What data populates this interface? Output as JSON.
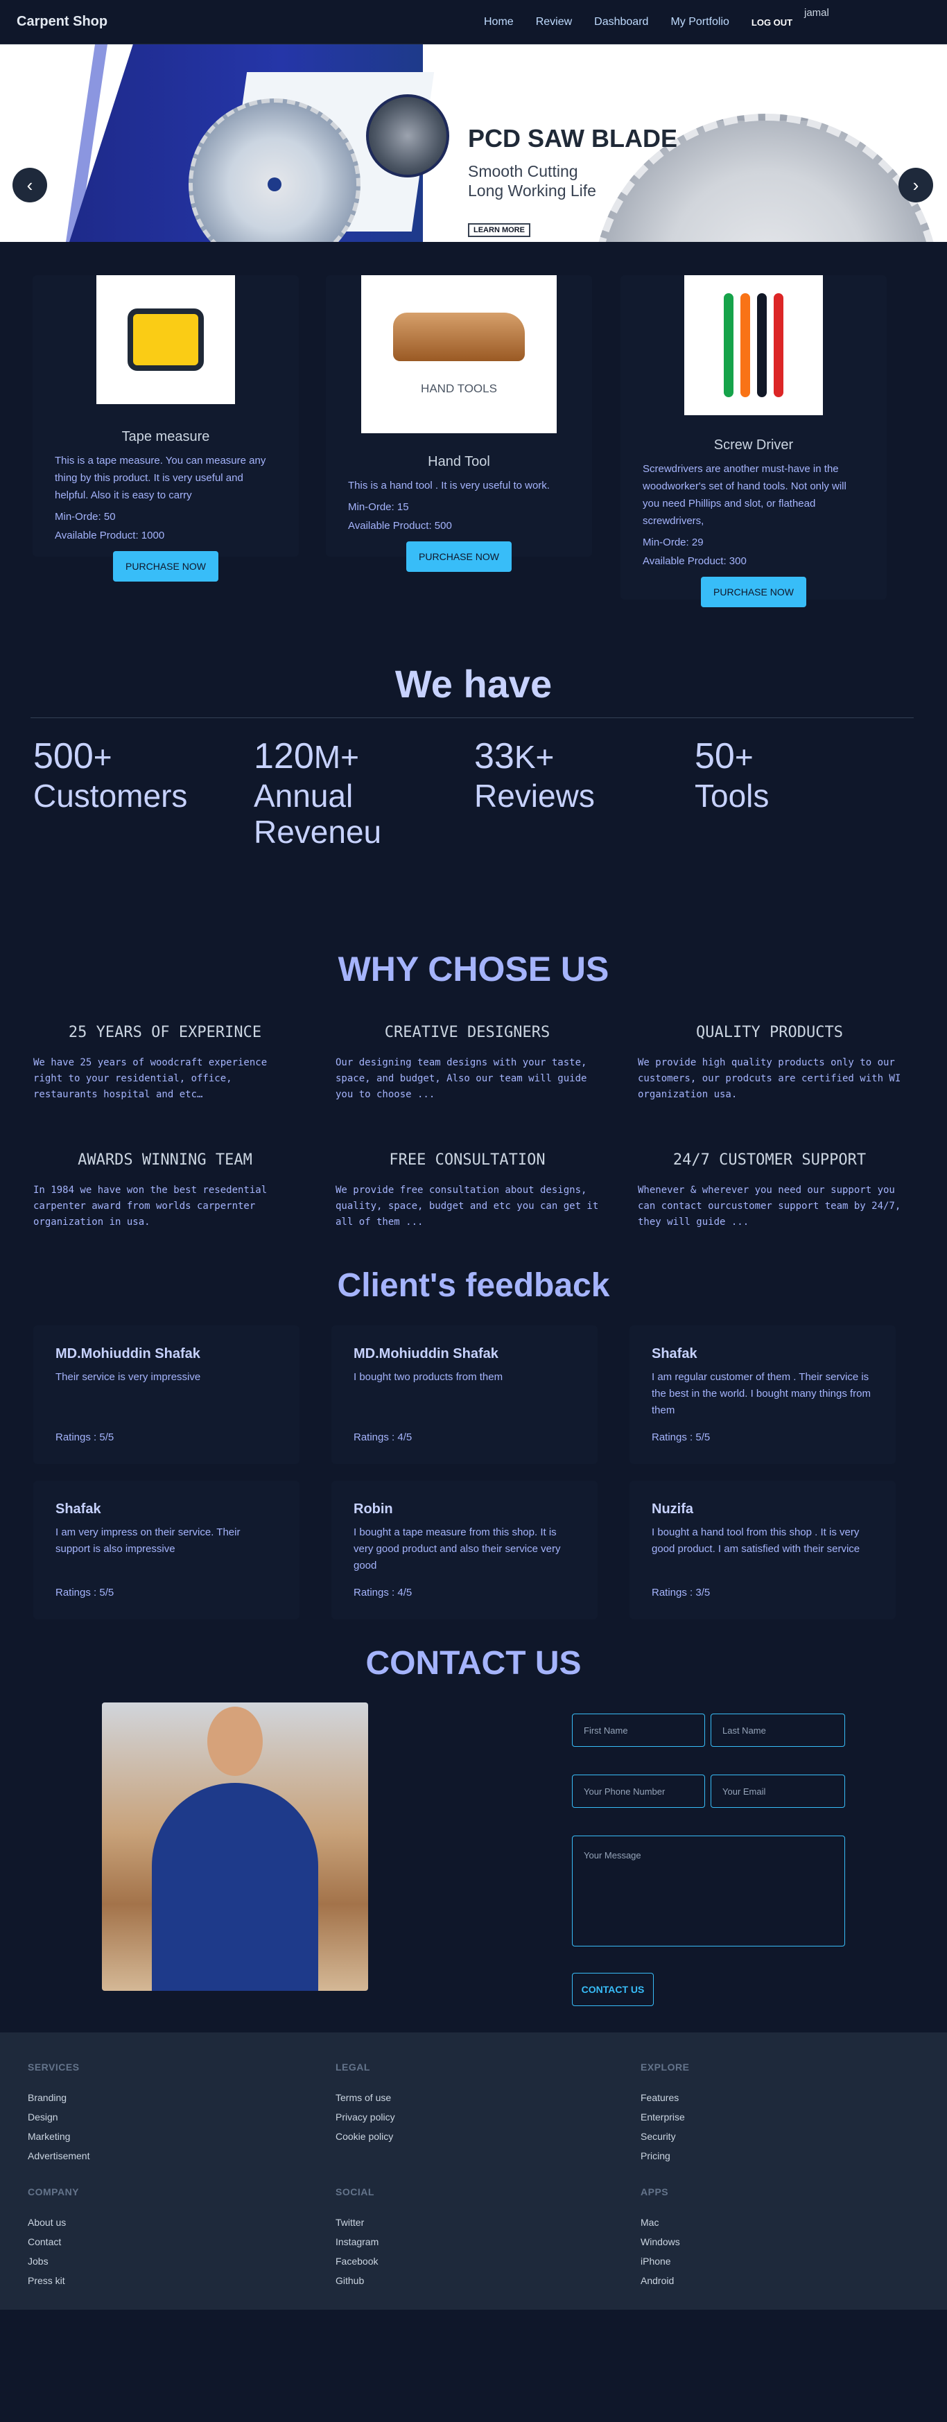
{
  "nav": {
    "brand": "Carpent Shop",
    "links": [
      "Home",
      "Review",
      "Dashboard",
      "My Portfolio"
    ],
    "logout": "LOG OUT",
    "user": "jamal"
  },
  "hero": {
    "title": "PCD SAW BLADE",
    "subtitle_line1": "Smooth Cutting",
    "subtitle_line2": "Long Working Life",
    "button": "LEARN MORE",
    "prev_icon": "‹",
    "next_icon": "›"
  },
  "products": [
    {
      "name": "Tape measure",
      "description": "This is a tape measure. You can measure any thing by this product. It is very useful and helpful. Also it is easy to carry",
      "min_order": "Min-Orde: 50",
      "available": "Available Product: 1000",
      "button": "PURCHASE NOW"
    },
    {
      "name": "Hand Tool",
      "image_text": "HAND TOOLS",
      "description": "This is a hand tool . It is very useful to work.",
      "min_order": "Min-Orde: 15",
      "available": "Available Product: 500",
      "button": "PURCHASE NOW"
    },
    {
      "name": "Screw Driver",
      "description": "Screwdrivers are another must-have in the woodworker's set of hand tools. Not only will you need Phillips and slot, or flathead screwdrivers,",
      "min_order": "Min-Orde: 29",
      "available": "Available Product: 300",
      "button": "PURCHASE NOW"
    }
  ],
  "stats": {
    "title": "We have",
    "items": [
      {
        "number": "500",
        "suffix": "+",
        "label": "Customers"
      },
      {
        "number": "120",
        "suffix": "M+",
        "label": "Annual Reveneu"
      },
      {
        "number": "33",
        "suffix": "K+",
        "label": "Reviews"
      },
      {
        "number": "50",
        "suffix": "+",
        "label": "Tools"
      }
    ]
  },
  "why": {
    "title": "WHY CHOSE US",
    "items": [
      {
        "title": "25 YEARS OF EXPERINCE",
        "text": "We have 25 years of woodcraft experience right to your residential, office, restaurants hospital and etc…"
      },
      {
        "title": "CREATIVE DESIGNERS",
        "text": "Our designing team designs with your taste, space, and budget, Also our team will guide you to choose ..."
      },
      {
        "title": "QUALITY PRODUCTS",
        "text": "We provide high quality products only to our customers, our prodcuts are certified with WI organization usa."
      },
      {
        "title": "AWARDS WINNING TEAM",
        "text": "In 1984 we have won the best resedential carpenter award from worlds carpernter organization in usa."
      },
      {
        "title": "FREE CONSULTATION",
        "text": "We provide free consultation about designs, quality, space, budget and etc you can get it all of them ..."
      },
      {
        "title": "24/7 CUSTOMER SUPPORT",
        "text": "Whenever & wherever you need our support you can contact ourcustomer support team by 24/7, they will guide ..."
      }
    ]
  },
  "feedback": {
    "title": "Client's feedback",
    "items": [
      {
        "name": "MD.Mohiuddin Shafak",
        "text": "Their service is very impressive",
        "rating": "Ratings : 5/5"
      },
      {
        "name": "MD.Mohiuddin Shafak",
        "text": "I bought two products from them",
        "rating": "Ratings : 4/5"
      },
      {
        "name": "Shafak",
        "text": "I am regular customer of them . Their service is the best in the world. I bought many things from them",
        "rating": "Ratings : 5/5"
      },
      {
        "name": "Shafak",
        "text": "I am very impress on their service. Their support is also impressive",
        "rating": "Ratings : 5/5"
      },
      {
        "name": "Robin",
        "text": "I bought a tape measure from this shop. It is very good product and also their service very good",
        "rating": "Ratings : 4/5"
      },
      {
        "name": "Nuzifa",
        "text": "I bought a hand tool from this shop . It is very good product. I am satisfied with their service",
        "rating": "Ratings : 3/5"
      }
    ]
  },
  "contact": {
    "title": "CONTACT US",
    "first_name": "First Name",
    "last_name": "Last Name",
    "phone": "Your Phone Number",
    "email": "Your Email",
    "message": "Your Message",
    "button": "CONTACT US"
  },
  "footer": {
    "columns": [
      {
        "title": "SERVICES",
        "items": [
          "Branding",
          "Design",
          "Marketing",
          "Advertisement"
        ]
      },
      {
        "title": "LEGAL",
        "items": [
          "Terms of use",
          "Privacy policy",
          "Cookie policy"
        ]
      },
      {
        "title": "EXPLORE",
        "items": [
          "Features",
          "Enterprise",
          "Security",
          "Pricing"
        ]
      },
      {
        "title": "COMPANY",
        "items": [
          "About us",
          "Contact",
          "Jobs",
          "Press kit"
        ]
      },
      {
        "title": "SOCIAL",
        "items": [
          "Twitter",
          "Instagram",
          "Facebook",
          "Github"
        ]
      },
      {
        "title": "APPS",
        "items": [
          "Mac",
          "Windows",
          "iPhone",
          "Android"
        ]
      }
    ]
  }
}
